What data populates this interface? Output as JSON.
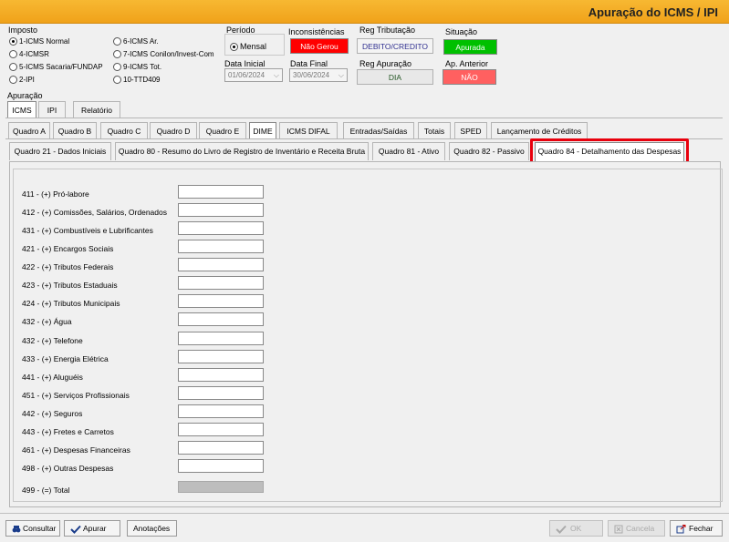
{
  "window": {
    "title": "Apuração do ICMS / IPI"
  },
  "imposto": {
    "label": "Imposto",
    "options": [
      {
        "label": "1-ICMS Normal",
        "selected": true
      },
      {
        "label": "4-ICMSR",
        "selected": false
      },
      {
        "label": "5-ICMS Sacaria/FUNDAP",
        "selected": false
      },
      {
        "label": "2-IPI",
        "selected": false
      },
      {
        "label": "6-ICMS Ar.",
        "selected": false
      },
      {
        "label": "7-ICMS Conilon/Invest-Com",
        "selected": false
      },
      {
        "label": "9-ICMS Tot.",
        "selected": false
      },
      {
        "label": "10-TTD409",
        "selected": false
      }
    ]
  },
  "periodo": {
    "label": "Período",
    "option": "Mensal"
  },
  "datas": {
    "inicial_label": "Data Inicial",
    "inicial": "01/06/2024",
    "final_label": "Data Final",
    "final": "30/06/2024"
  },
  "inconsistencias": {
    "label": "Inconsistências",
    "value": "Não Gerou",
    "color": "#ff0000"
  },
  "reg_tributacao": {
    "label": "Reg Tributação",
    "value": "DEBITO/CREDITO"
  },
  "reg_apuracao": {
    "label": "Reg Apuração",
    "value": "DIA"
  },
  "situacao": {
    "label": "Situação",
    "value": "Apurada",
    "color": "#00c000"
  },
  "ap_anterior": {
    "label": "Ap. Anterior",
    "value": "NÃO",
    "color": "#ff6060"
  },
  "apuracao": {
    "label": "Apuração",
    "tabs": [
      "ICMS",
      "IPI",
      "Relatório"
    ]
  },
  "section_tabs": [
    "Quadro A",
    "Quadro B",
    "Quadro C",
    "Quadro D",
    "Quadro E",
    "DIME",
    "ICMS DIFAL",
    "Entradas/Saídas",
    "Totais",
    "SPED",
    "Lançamento de Créditos"
  ],
  "quadro_tabs": [
    "Quadro 21 - Dados Iniciais",
    "Quadro 80 - Resumo do Livro de Registro de Inventário e Receita Bruta",
    "Quadro 81 - Ativo",
    "Quadro 82 - Passivo",
    "Quadro 84 - Detalhamento das Despesas"
  ],
  "despesas": [
    "411 - (+) Pró-labore",
    "412 - (+) Comissões, Salários, Ordenados",
    "431 - (+) Combustíveis e Lubrificantes",
    "421 - (+) Encargos Sociais",
    "422 - (+) Tributos Federais",
    "423 - (+) Tributos Estaduais",
    "424 - (+) Tributos Municipais",
    "432 - (+) Água",
    "432 - (+) Telefone",
    "433 - (+) Energia Elétrica",
    "441 - (+) Aluguéis",
    "451 - (+) Serviços Profissionais",
    "442 - (+) Seguros",
    "443 - (+) Fretes e Carretos",
    "461 - (+) Despesas Financeiras",
    "498 - (+) Outras Despesas"
  ],
  "total_label": "499 - (=) Total",
  "footer": {
    "consultar": "Consultar",
    "apurar": "Apurar",
    "anotacoes": "Anotações",
    "ok": "OK",
    "cancela": "Cancela",
    "fechar": "Fechar"
  }
}
